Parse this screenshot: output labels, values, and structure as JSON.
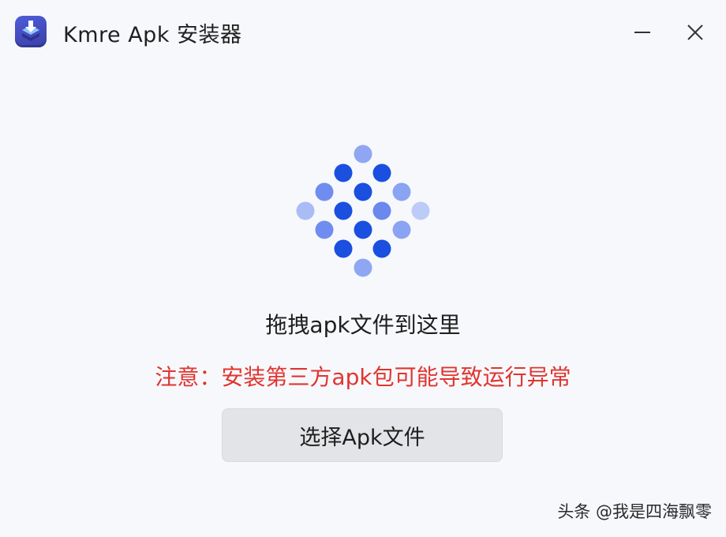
{
  "window": {
    "title": "Kmre Apk 安装器",
    "app_icon": "apk-installer-icon",
    "minimize_icon": "minimize-icon",
    "close_icon": "close-icon"
  },
  "main": {
    "drop_icon": "dot-grid-drop-icon",
    "drag_hint": "拖拽apk文件到这里",
    "warning": "注意：安装第三方apk包可能导致运行异常",
    "select_button_label": "选择Apk文件"
  },
  "watermark": "头条 @我是四海飘零",
  "colors": {
    "accent_blue": "#1a4fe0",
    "warning_red": "#e0352f",
    "button_bg": "#e3e4e7"
  }
}
